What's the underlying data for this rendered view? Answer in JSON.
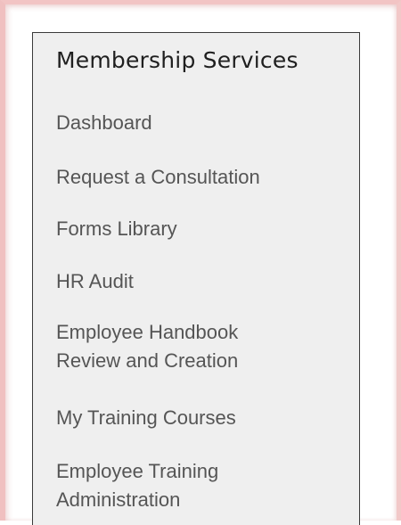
{
  "sidebar": {
    "title": "Membership Services",
    "items": [
      {
        "label": "Dashboard"
      },
      {
        "label": "Request a Consultation"
      },
      {
        "label": "Forms Library"
      },
      {
        "label": "HR Audit"
      },
      {
        "label_line1": "Employee Handbook",
        "label_line2": "Review and Creation"
      },
      {
        "label": "My Training Courses"
      },
      {
        "label_line1": "Employee Training",
        "label_line2": "Administration"
      }
    ]
  },
  "colors": {
    "panel_background": "#efefef",
    "panel_border": "#3a3a3a",
    "frame_border": "#f0c0c0",
    "title_text": "#1f1f1f",
    "link_text": "#555555"
  }
}
